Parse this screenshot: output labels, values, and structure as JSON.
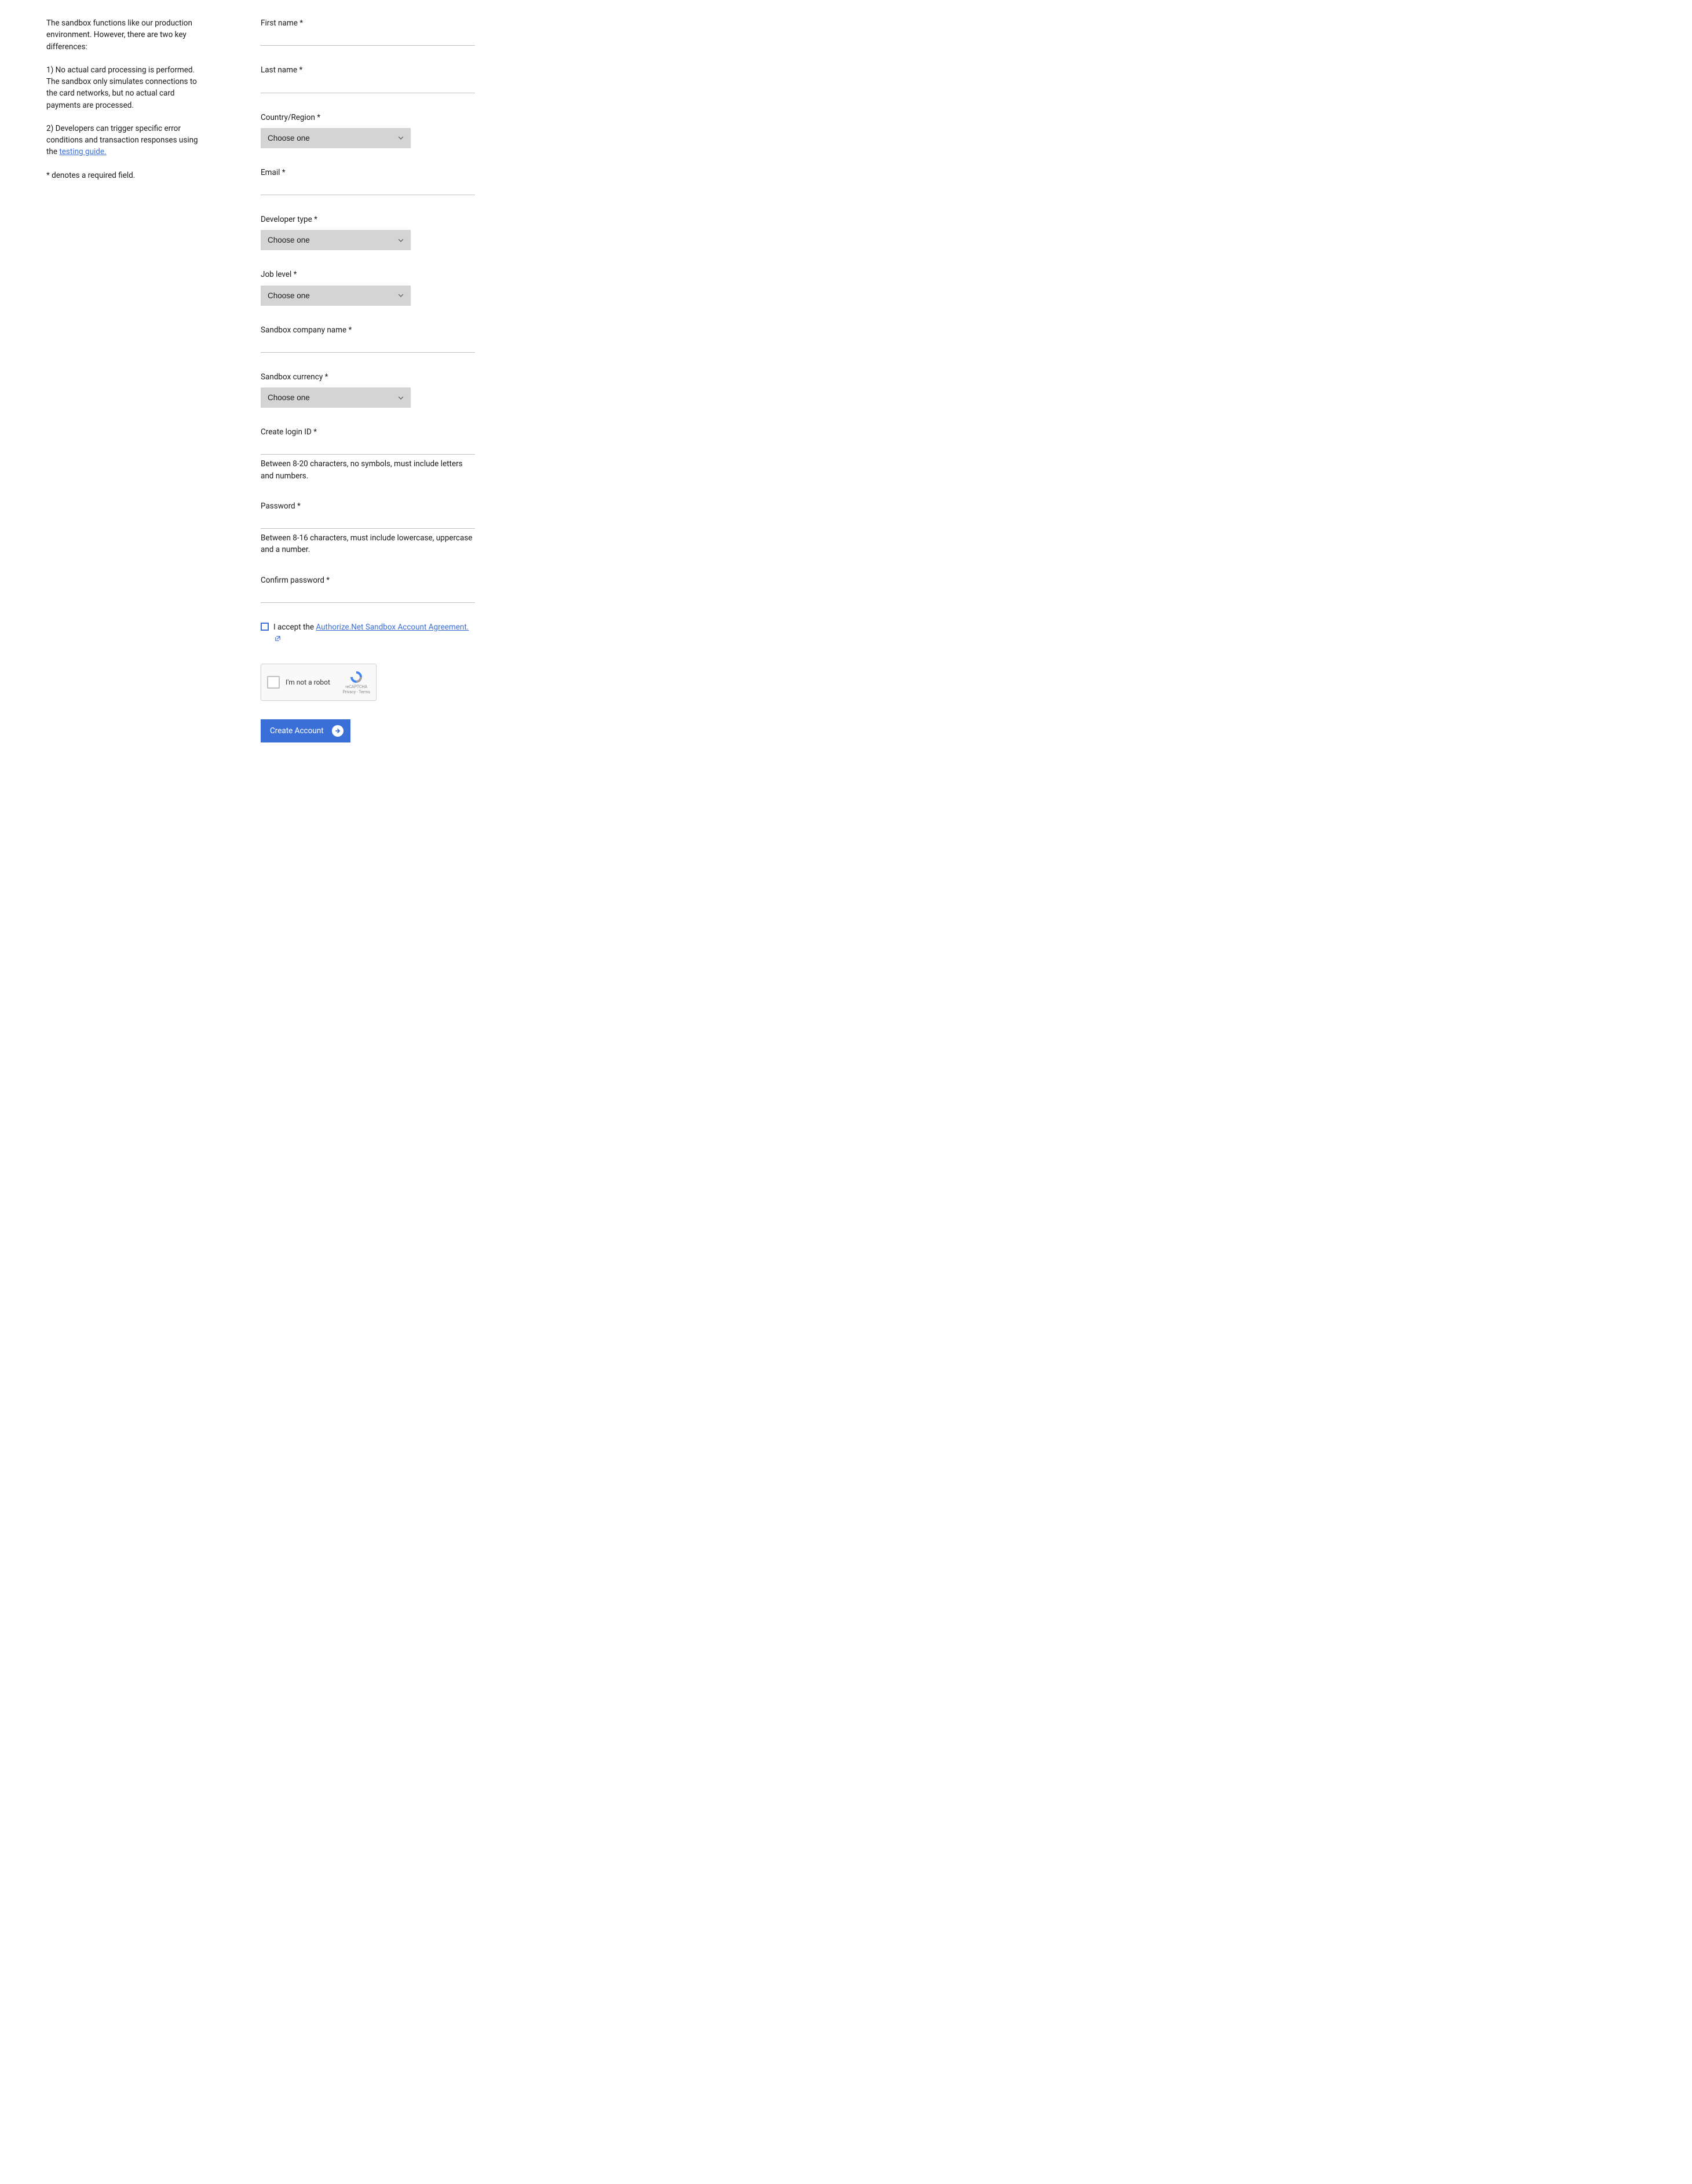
{
  "left": {
    "intro": "The sandbox functions like our production environment. However, there are two key differences:",
    "point1": "1) No actual card processing is performed. The sandbox only simulates connections to the card networks, but no actual card payments are processed.",
    "point2_prefix": "2) Developers can trigger specific error conditions and transaction responses using the ",
    "point2_link": "testing guide.",
    "required_note": "* denotes a required field."
  },
  "form": {
    "first_name_label": "First name *",
    "last_name_label": "Last name *",
    "country_label": "Country/Region *",
    "country_value": "Choose one",
    "email_label": "Email *",
    "dev_type_label": "Developer type *",
    "dev_type_value": "Choose one",
    "job_level_label": "Job level *",
    "job_level_value": "Choose one",
    "company_label": "Sandbox company name *",
    "currency_label": "Sandbox currency *",
    "currency_value": "Choose one",
    "login_label": "Create login ID *",
    "login_hint": "Between 8-20 characters, no symbols, must include letters and numbers.",
    "password_label": "Password *",
    "password_hint": "Between 8-16 characters, must include lowercase, uppercase and a number.",
    "confirm_label": "Confirm password *",
    "accept_prefix": "I accept the  ",
    "accept_link": "Authorize.Net Sandbox Account Agreement.",
    "recaptcha_label": "I'm not a robot",
    "recaptcha_brand": "reCAPTCHA",
    "recaptcha_terms": "Privacy - Terms",
    "submit_label": "Create Account"
  }
}
